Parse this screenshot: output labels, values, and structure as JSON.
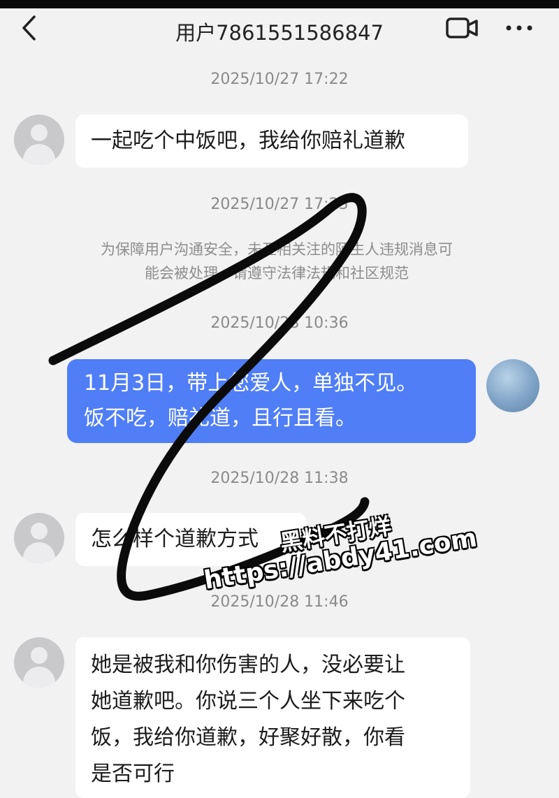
{
  "header": {
    "title": "用户7861551586847",
    "back_icon": "chevron-left-icon",
    "video_icon": "video-camera-icon",
    "more_icon": "more-dots-icon"
  },
  "messages": [
    {
      "timestamp": "2025/10/27 17:22",
      "sender": "other",
      "lines": [
        "一起吃个中饭吧，我给你赔礼道歉"
      ]
    },
    {
      "timestamp": "2025/10/27 17:23",
      "notice": [
        "为保障用户沟通安全，未互相关注的陌生人违规消息可",
        "能会被处理，请遵守法律法规和社区规范"
      ]
    },
    {
      "timestamp": "2025/10/28 10:36",
      "sender": "me",
      "lines": [
        "11月3日，带上您爱人，单独不见。",
        "饭不吃，赔礼道，且行且看。"
      ]
    },
    {
      "timestamp": "2025/10/28 11:38",
      "sender": "other",
      "lines": [
        "怎么样个道歉方式"
      ]
    },
    {
      "timestamp": "2025/10/28 11:46",
      "sender": "other",
      "lines": [
        "她是被我和你伤害的人，没必要让",
        "她道歉吧。你说三个人坐下来吃个",
        "饭，我给你道歉，好聚好散，你看",
        "是否可行"
      ]
    }
  ],
  "watermark": {
    "line1": "黑料不打烊",
    "line2": "https://abdy41.com"
  },
  "colors": {
    "background": "#f2f2f3",
    "bubble_me": "#4f7ef7",
    "bubble_other": "#ffffff",
    "timestamp": "#8a8a8a"
  }
}
